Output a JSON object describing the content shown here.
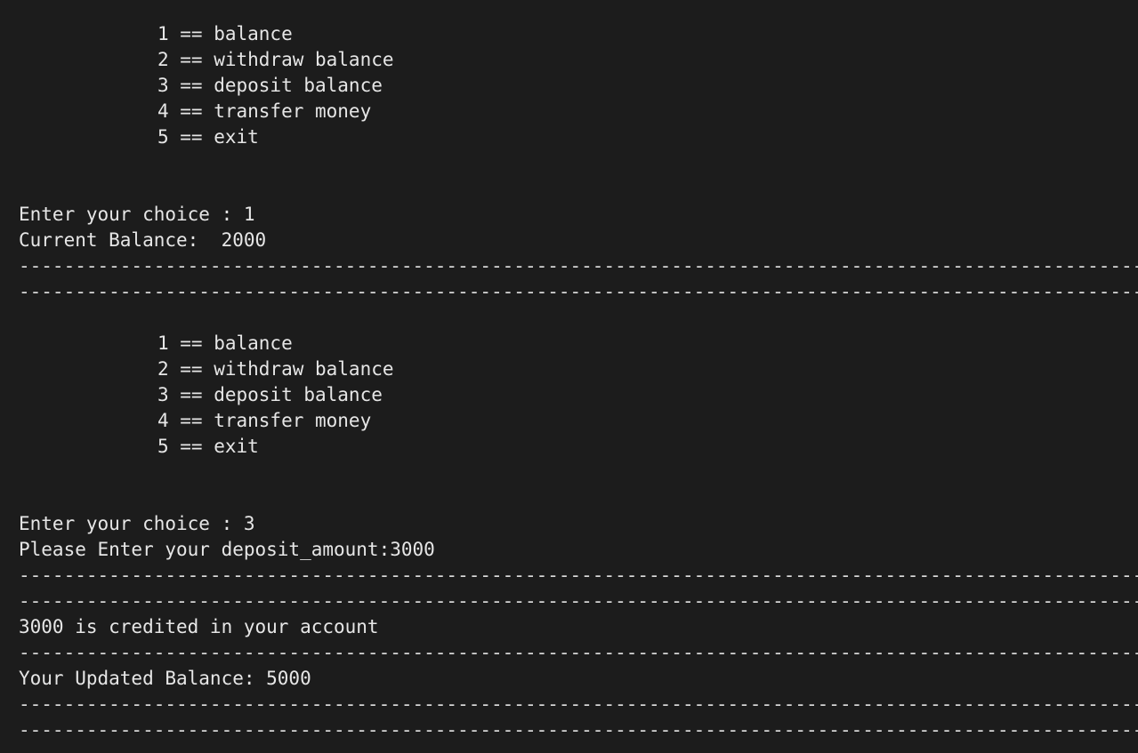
{
  "terminal": {
    "lines": [
      {
        "kind": "menu",
        "text": "1 == balance"
      },
      {
        "kind": "menu",
        "text": "2 == withdraw balance"
      },
      {
        "kind": "menu",
        "text": "3 == deposit balance"
      },
      {
        "kind": "menu",
        "text": "4 == transfer money"
      },
      {
        "kind": "menu",
        "text": "5 == exit"
      },
      {
        "kind": "blank",
        "text": ""
      },
      {
        "kind": "blank",
        "text": ""
      },
      {
        "kind": "text",
        "text": "Enter your choice : 1"
      },
      {
        "kind": "text",
        "text": "Current Balance:  2000"
      },
      {
        "kind": "sep",
        "text": "-----------------------------------------------------------------------------------------------------------------------------------"
      },
      {
        "kind": "sep",
        "text": "-----------------------------------------------------------------------------------------------------------------------------------"
      },
      {
        "kind": "blank",
        "text": ""
      },
      {
        "kind": "menu",
        "text": "1 == balance"
      },
      {
        "kind": "menu",
        "text": "2 == withdraw balance"
      },
      {
        "kind": "menu",
        "text": "3 == deposit balance"
      },
      {
        "kind": "menu",
        "text": "4 == transfer money"
      },
      {
        "kind": "menu",
        "text": "5 == exit"
      },
      {
        "kind": "blank",
        "text": ""
      },
      {
        "kind": "blank",
        "text": ""
      },
      {
        "kind": "text",
        "text": "Enter your choice : 3"
      },
      {
        "kind": "text",
        "text": "Please Enter your deposit_amount:3000"
      },
      {
        "kind": "sep",
        "text": "-----------------------------------------------------------------------------------------------------------------------------------"
      },
      {
        "kind": "sep",
        "text": "-----------------------------------------------------------------------------------------------------------------------------------"
      },
      {
        "kind": "text",
        "text": "3000 is credited in your account"
      },
      {
        "kind": "sep",
        "text": "-----------------------------------------------------------------------------------------------------------------------------------"
      },
      {
        "kind": "text",
        "text": "Your Updated Balance: 5000"
      },
      {
        "kind": "sep",
        "text": "-----------------------------------------------------------------------------------------------------------------------------------"
      },
      {
        "kind": "sep",
        "text": "-----------------------------------------------------------------------------------------------------------------------------------"
      }
    ]
  }
}
